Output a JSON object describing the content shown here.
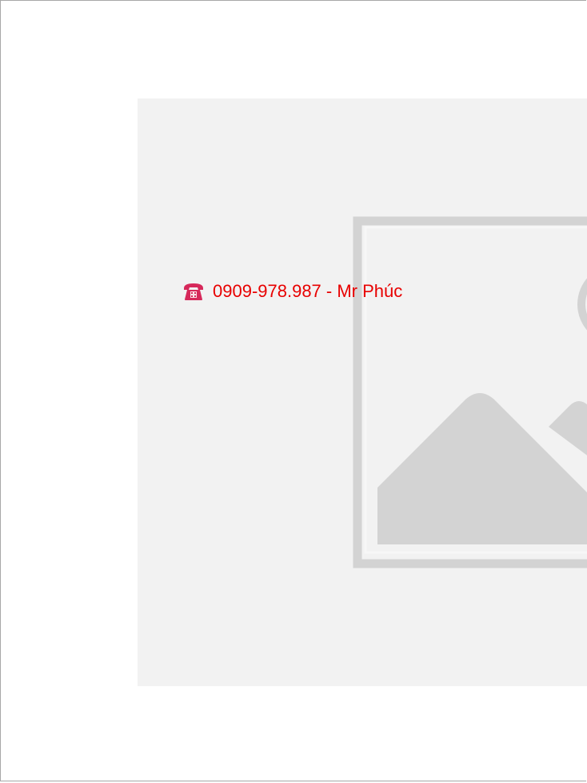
{
  "contact": {
    "icon": "telephone-icon",
    "text": "0909-978.987 - Mr Phúc",
    "color": "#e80000"
  },
  "placeholder": {
    "icon": "image-placeholder-icon",
    "background": "#f2f2f2",
    "shape_color": "#d3d3d3"
  }
}
